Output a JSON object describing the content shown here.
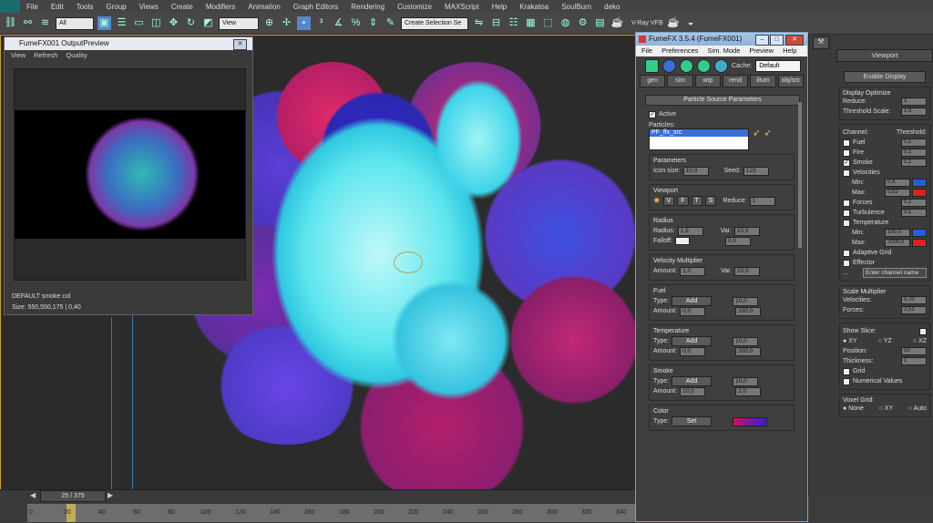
{
  "menubar": {
    "items": [
      "File",
      "Edit",
      "Tools",
      "Group",
      "Views",
      "Create",
      "Modifiers",
      "Animation",
      "Graph Editors",
      "Rendering",
      "Customize",
      "MAXScript",
      "Help",
      "Krakatoa",
      "SoulBurn",
      "deko"
    ]
  },
  "toolbar": {
    "filter_select": "All",
    "view_select": "View",
    "selection_set_placeholder": "Create Selection Se",
    "vray_label": "V-Ray VFB"
  },
  "preview": {
    "title": "FumeFX001 OutputPreview",
    "menu": [
      "View",
      "Refresh",
      "Quality"
    ],
    "channel": "DEFAULT smoke col",
    "size": "Size: 550,550,175 | 0,40"
  },
  "timeline": {
    "frame_display": "25 / 375",
    "ticks": [
      "0",
      "20",
      "40",
      "60",
      "80",
      "100",
      "120",
      "140",
      "160",
      "180",
      "200",
      "220",
      "240",
      "260",
      "280",
      "300",
      "320",
      "340"
    ]
  },
  "fumefx": {
    "title": "FumeFX 3.5.4 (FumeFX001)",
    "menu": [
      "File",
      "Preferences",
      "Sim. Mode",
      "Preview",
      "Help"
    ],
    "cache_label": "Cache:",
    "cache_value": "Default",
    "tabs": [
      "gen",
      "sim",
      "wtp",
      "rend",
      "illum",
      "obj/src"
    ],
    "rollout_title": "Particle Source Parameters",
    "active_label": "Active",
    "particles_label": "Particles:",
    "particle_item": "PF_ffx_src",
    "parameters": {
      "title": "Parameters",
      "icon_size_label": "Icon size:",
      "icon_size": "10,0",
      "seed_label": "Seed:",
      "seed": "123"
    },
    "viewport": {
      "title": "Viewport",
      "buttons": [
        "V",
        "F",
        "T",
        "S"
      ],
      "reduce_label": "Reduce:",
      "reduce": "1"
    },
    "radius": {
      "title": "Radius",
      "radius_label": "Radius:",
      "radius": "1,5",
      "var_label": "Var.",
      "var": "10,0",
      "falloff_label": "Falloff:",
      "pct": "0,0"
    },
    "velocity": {
      "title": "Velocity Multiplier",
      "amount_label": "Amount:",
      "amount": "1,0",
      "var_label": "Var.",
      "var": "10,0",
      "pct": "0,0"
    },
    "fuel": {
      "title": "Fuel",
      "type_label": "Type:",
      "type_button": "Add",
      "amount_label": "Amount:",
      "amount": "0,0",
      "var_label": "Var.",
      "var": "10,0",
      "pct": "100,0"
    },
    "temperature": {
      "title": "Temperature",
      "type_label": "Type:",
      "type_button": "Add",
      "amount_label": "Amount:",
      "amount": "0,0",
      "var_label": "Var.",
      "var": "10,0",
      "pct": "300,0"
    },
    "smoke": {
      "title": "Smoke",
      "type_label": "Type:",
      "type_button": "Add",
      "amount_label": "Amount:",
      "amount": "10,0",
      "var_label": "Var.",
      "var": "10,0",
      "pct": "2,0"
    },
    "color": {
      "title": "Color",
      "type_label": "Type:",
      "type_button": "Set"
    }
  },
  "rpanel": {
    "title": "Viewport",
    "enable_button": "Enable Display",
    "display_optimize": {
      "title": "Display Optimize",
      "reduce_label": "Reduce:",
      "reduce": "2",
      "threshold_label": "Threshold Scale:",
      "threshold": "1,0"
    },
    "channels_header": [
      "Channel:",
      "Threshold:"
    ],
    "channels": [
      {
        "name": "Fuel",
        "value": "0,1",
        "checked": false
      },
      {
        "name": "Fire",
        "value": "0,1",
        "checked": false
      },
      {
        "name": "Smoke",
        "value": "0,1",
        "checked": true
      },
      {
        "name": "Velocities",
        "value": "",
        "checked": false
      }
    ],
    "velocities_min": {
      "label": "Min:",
      "value": "0,4"
    },
    "velocities_max": {
      "label": "Max:",
      "value": "0,52"
    },
    "forces": {
      "name": "Forces",
      "value": "0,1"
    },
    "turbulence": {
      "name": "Turbulence",
      "value": "0,1"
    },
    "temperature": {
      "name": "Temperature"
    },
    "temp_min": {
      "label": "Min:",
      "value": "100,0"
    },
    "temp_max": {
      "label": "Max:",
      "value": "2000,0"
    },
    "adaptive": "Adaptive Grid",
    "effector": "Effector",
    "channel_input_placeholder": "Enter channel name",
    "scale": {
      "title": "Scale Multiplier",
      "velocities_label": "Velocities:",
      "velocities": "5,70",
      "forces_label": "Forces:",
      "forces": "2,51"
    },
    "slice": {
      "title": "Show Slice:",
      "options": [
        "XY",
        "YZ",
        "XZ"
      ],
      "position_label": "Position:",
      "position": "50",
      "thickness_label": "Thickness:",
      "thickness": "1"
    },
    "grid": "Grid",
    "numerical": "Numerical Values",
    "voxel": {
      "title": "Voxel Grid:",
      "options": [
        "None",
        "XY",
        "Auto"
      ]
    }
  }
}
